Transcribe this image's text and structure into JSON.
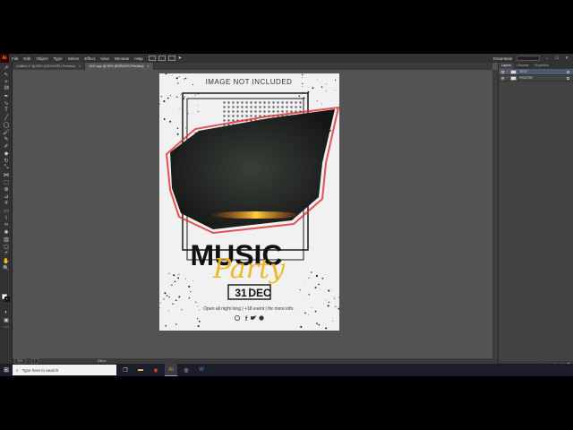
{
  "menu": {
    "app_logo": "Ai",
    "items": [
      "File",
      "Edit",
      "Object",
      "Type",
      "Select",
      "Effect",
      "View",
      "Window",
      "Help"
    ],
    "workspace": "Essentials",
    "window_controls": [
      "–",
      "☐",
      "✕"
    ]
  },
  "tabs": [
    {
      "label": "Untitled-1* @ 85% (CMYK/GPU Preview)",
      "close": "×"
    },
    {
      "label": "1917.eps @ 90% (RGB/GPU Preview)",
      "close": "×"
    }
  ],
  "poster": {
    "top_text": "IMAGE NOT INCLUDED",
    "title": "MUSIC",
    "script": "Party",
    "date_day": "31",
    "date_month": "DEC",
    "info": "Open all night long | +18 event | for more info.",
    "social_icons": [
      "instagram-icon",
      "facebook-icon",
      "twitter-icon",
      "whatsapp-icon"
    ]
  },
  "status": {
    "zoom": "90%",
    "page": "1",
    "tool": "Ellipse"
  },
  "panel": {
    "tabs": [
      "Layers",
      "Libraries",
      "Properties"
    ],
    "layers": [
      {
        "name": "TEXT",
        "selected": true
      },
      {
        "name": "POSTER",
        "selected": false
      }
    ],
    "footer_icons": [
      "export-icon",
      "search-icon",
      "new-sublayer-icon",
      "new-layer-icon",
      "delete-icon"
    ]
  },
  "taskbar": {
    "search_placeholder": "Type here to search",
    "apps": [
      "task-view-icon",
      "file-explorer-icon",
      "chrome-icon",
      "illustrator-icon",
      "obs-icon",
      "word-icon"
    ]
  },
  "colors": {
    "poster_accent": "#f0b41e",
    "brush_red": "#e02a2a",
    "panel_bg": "#424242",
    "workspace_bg": "#535353"
  }
}
